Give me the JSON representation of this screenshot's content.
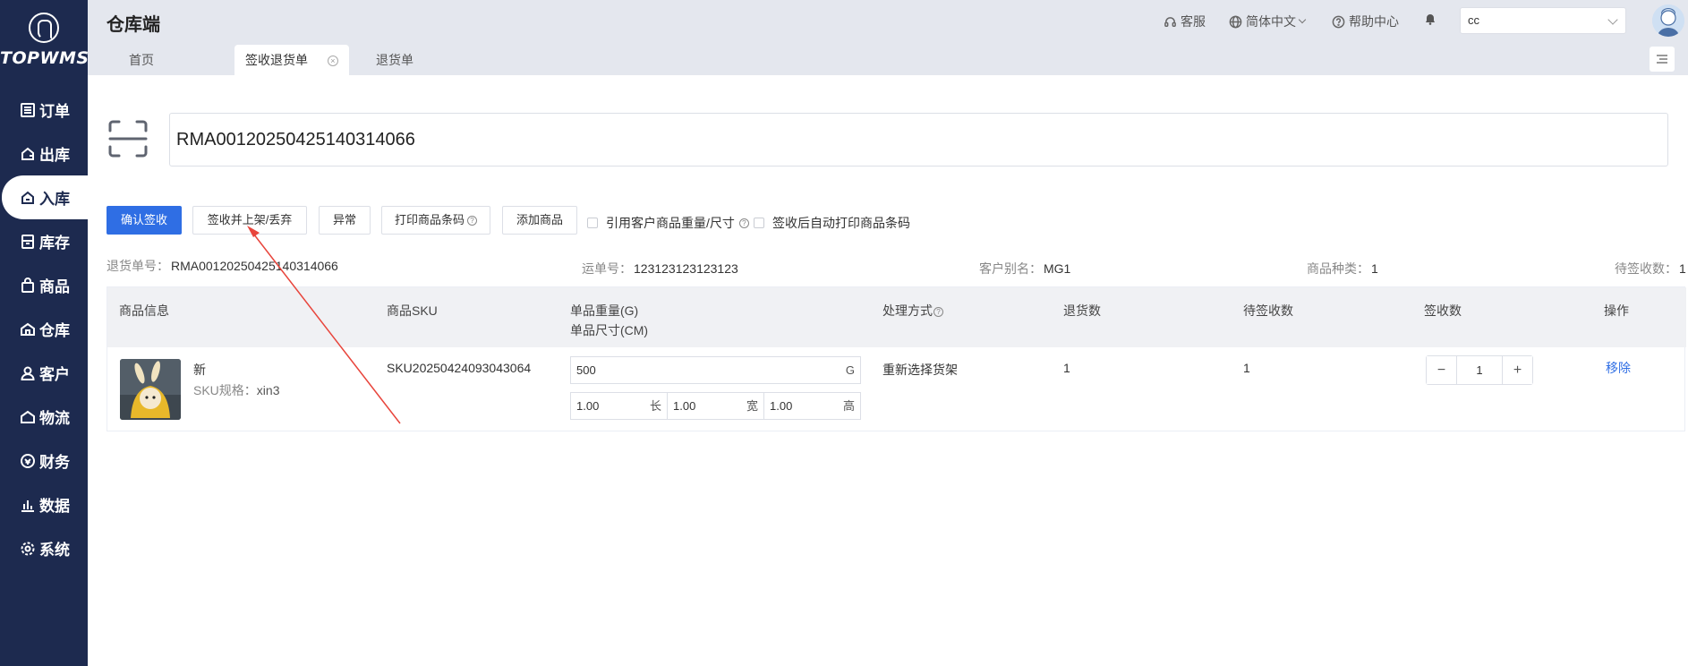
{
  "sidebar": {
    "logo": "TOPWMS",
    "items": [
      {
        "label": "订单",
        "icon": "list-icon"
      },
      {
        "label": "出库",
        "icon": "outbound-icon"
      },
      {
        "label": "入库",
        "icon": "inbound-icon"
      },
      {
        "label": "库存",
        "icon": "inventory-icon"
      },
      {
        "label": "商品",
        "icon": "bag-icon"
      },
      {
        "label": "仓库",
        "icon": "warehouse-icon"
      },
      {
        "label": "客户",
        "icon": "user-icon"
      },
      {
        "label": "物流",
        "icon": "logistics-icon"
      },
      {
        "label": "财务",
        "icon": "finance-icon"
      },
      {
        "label": "数据",
        "icon": "chart-icon"
      },
      {
        "label": "系统",
        "icon": "settings-icon"
      }
    ],
    "active_index": 2
  },
  "header": {
    "title": "仓库端",
    "service": "客服",
    "language": "简体中文",
    "help": "帮助中心",
    "user": "cc"
  },
  "tabs": [
    {
      "label": "首页"
    },
    {
      "label": "签收退货单"
    },
    {
      "label": "退货单"
    }
  ],
  "scanner": {
    "value": "RMA00120250425140314066"
  },
  "toolbar": {
    "confirm": "确认签收",
    "sign_shelve": "签收并上架/丢弃",
    "exception": "异常",
    "print_barcode": "打印商品条码",
    "add_product": "添加商品",
    "opt_customer_weight": "引用客户商品重量/尺寸",
    "opt_auto_print": "签收后自动打印商品条码"
  },
  "info": {
    "return_no_label": "退货单号：",
    "return_no": "RMA00120250425140314066",
    "tracking_label": "运单号：",
    "tracking": "123123123123123",
    "customer_label": "客户别名：",
    "customer": "MG1",
    "kinds_label": "商品种类：",
    "kinds": "1",
    "pending_label": "待签收数：",
    "pending": "1"
  },
  "table": {
    "headers": {
      "product": "商品信息",
      "sku": "商品SKU",
      "weight": "单品重量(G)",
      "size": "单品尺寸(CM)",
      "method": "处理方式",
      "returned": "退货数",
      "pending": "待签收数",
      "signed": "签收数",
      "action": "操作"
    },
    "row": {
      "name": "新",
      "spec_label": "SKU规格：",
      "spec": "xin3",
      "sku": "SKU20250424093043064",
      "weight": "500",
      "weight_unit": "G",
      "length": "1.00",
      "length_unit": "长",
      "width": "1.00",
      "width_unit": "宽",
      "height": "1.00",
      "height_unit": "高",
      "method": "重新选择货架",
      "returned": "1",
      "pending": "1",
      "signed": "1",
      "action": "移除"
    }
  },
  "colors": {
    "sidebar": "#1d2a4f",
    "primary": "#2f6ee4",
    "annotation": "#e8453c"
  }
}
